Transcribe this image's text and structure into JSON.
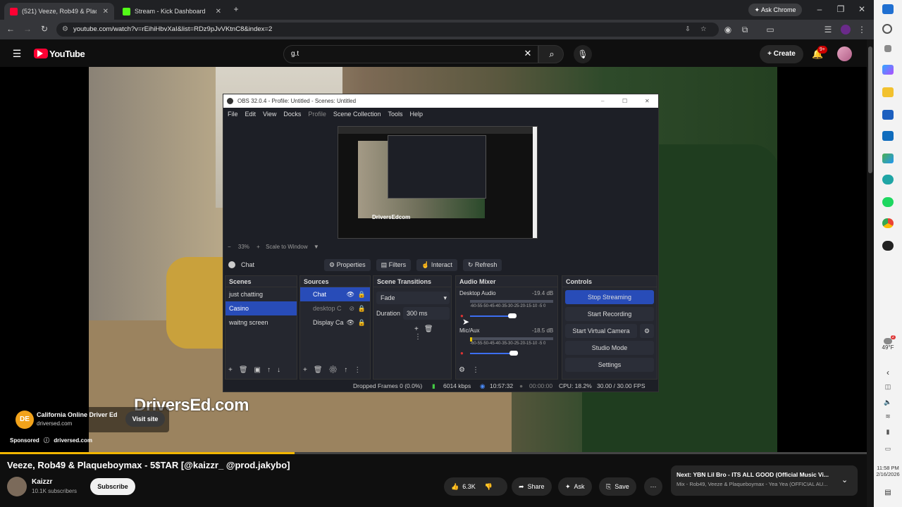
{
  "browser": {
    "tabs": [
      {
        "label": "(521) Veeze, Rob49 & Plaqueb",
        "active": true,
        "icon": "youtube-icon"
      },
      {
        "label": "Stream - Kick Dashboard",
        "active": false,
        "icon": "kick-icon"
      }
    ],
    "ask_chrome": "Ask Chrome",
    "url": "youtube.com/watch?v=rEihiHbvXaI&list=RDz9pJvVKtnC8&index=2"
  },
  "youtube": {
    "logo": "YouTube",
    "search_value": "g.t",
    "create_label": "Create",
    "notif_count": "9+"
  },
  "obs": {
    "title": "OBS 32.0.4 - Profile: Untitled - Scenes: Untitled",
    "menu": [
      "File",
      "Edit",
      "View",
      "Docks",
      "Profile",
      "Scene Collection",
      "Tools",
      "Help"
    ],
    "zoom": "33%",
    "scale_mode": "Scale to Window",
    "preview_caption": "DriversEdcom",
    "selected_source": "Chat",
    "source_buttons": {
      "properties": "Properties",
      "filters": "Filters",
      "interact": "Interact",
      "refresh": "Refresh"
    },
    "scenes": {
      "header": "Scenes",
      "items": [
        "just chatting",
        "Casino",
        "waitng screen"
      ],
      "selected": "Casino"
    },
    "sources": {
      "header": "Sources",
      "items": [
        "Chat",
        "desktop C",
        "Display Ca"
      ]
    },
    "transitions": {
      "header": "Scene Transitions",
      "type": "Fade",
      "duration_label": "Duration",
      "duration": "300 ms"
    },
    "mixer": {
      "header": "Audio Mixer",
      "channels": [
        {
          "name": "Desktop Audio",
          "db": "-19.4 dB"
        },
        {
          "name": "Mic/Aux",
          "db": "-18.5 dB"
        }
      ],
      "scale": "-60-55-50-45-40-35-30-25-20-15-10 -5 0"
    },
    "controls": {
      "header": "Controls",
      "stop_streaming": "Stop Streaming",
      "start_recording": "Start Recording",
      "start_virtual_camera": "Start Virtual Camera",
      "studio_mode": "Studio Mode",
      "settings": "Settings"
    },
    "status": {
      "dropped": "Dropped Frames 0 (0.0%)",
      "bitrate": "6014 kbps",
      "stream_time": "10:57:32",
      "rec_time": "00:00:00",
      "cpu": "CPU: 18.2%",
      "fps": "30.00 / 30.00 FPS"
    }
  },
  "video_overlay": {
    "brand_text": "DriversEd.com",
    "ad_name": "California Online Driver Ed",
    "ad_domain": "driversed.com",
    "visit_site": "Visit site",
    "sponsored": "Sponsored",
    "sponsored_domain": "driversed.com",
    "progress_fraction": 0.34
  },
  "video": {
    "title": "Veeze, Rob49 & Plaqueboymax - 5$TAR [@kaizzr_ @prod.jakybo]",
    "channel": "Kaizzr",
    "subscribers": "10.1K subscribers",
    "subscribe": "Subscribe",
    "likes": "6.3K",
    "share": "Share",
    "ask": "Ask",
    "save": "Save"
  },
  "next_up": {
    "title": "Next: YBN Lil Bro - ITS ALL GOOD (Official Music Vi...",
    "subtitle": "Mix - Rob49, Veeze & Plaqueboymax - Yea Yea (OFFICIAL AU..."
  },
  "taskbar": {
    "weather": "49°F",
    "time": "11:58 PM",
    "date": "2/16/2026",
    "weather_badge": "2"
  }
}
